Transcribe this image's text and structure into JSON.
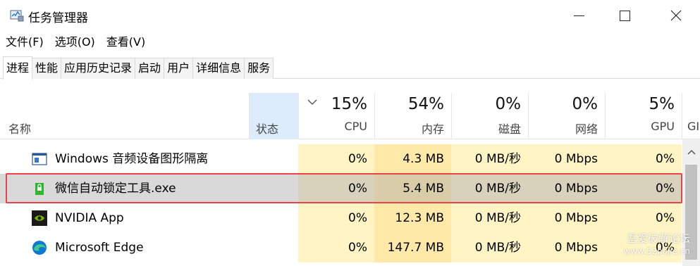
{
  "window": {
    "title": "任务管理器"
  },
  "menu": [
    "文件(F)",
    "选项(O)",
    "查看(V)"
  ],
  "tabs": [
    "进程",
    "性能",
    "应用历史记录",
    "启动",
    "用户",
    "详细信息",
    "服务"
  ],
  "active_tab": "进程",
  "header": {
    "name": "名称",
    "status": "状态",
    "columns": [
      {
        "pct": "15%",
        "label": "CPU"
      },
      {
        "pct": "54%",
        "label": "内存"
      },
      {
        "pct": "0%",
        "label": "磁盘"
      },
      {
        "pct": "0%",
        "label": "网络"
      },
      {
        "pct": "5%",
        "label": "GPU"
      },
      {
        "pct": "",
        "label": "GI"
      }
    ]
  },
  "rows": [
    {
      "name": "Windows 音频设备图形隔离",
      "icon": "windows-app-icon",
      "cpu": "0%",
      "memory": "4.3 MB",
      "disk": "0 MB/秒",
      "network": "0 Mbps",
      "gpu": "0%"
    },
    {
      "name": "微信自动锁定工具.exe",
      "icon": "lock-app-icon",
      "cpu": "0%",
      "memory": "5.4 MB",
      "disk": "0 MB/秒",
      "network": "0 Mbps",
      "gpu": "0%",
      "selected": true
    },
    {
      "name": "NVIDIA App",
      "icon": "nvidia-icon",
      "cpu": "0%",
      "memory": "12.3 MB",
      "disk": "0 MB/秒",
      "network": "0 Mbps",
      "gpu": "0%"
    },
    {
      "name": "Microsoft Edge",
      "icon": "edge-icon",
      "cpu": "0%",
      "memory": "147.7 MB",
      "disk": "0 MB/秒",
      "network": "0 Mbps",
      "gpu": "0%"
    }
  ],
  "watermark": {
    "line1": "吾爱破解论坛",
    "line2": "www.52pojie.cn"
  },
  "colors": {
    "heat_light": "#fff4c4",
    "heat_medium": "#ffe9a8",
    "selected_row": "#d9d9d9",
    "highlight_border": "#e8434a",
    "status_header": "#dcecfc"
  }
}
